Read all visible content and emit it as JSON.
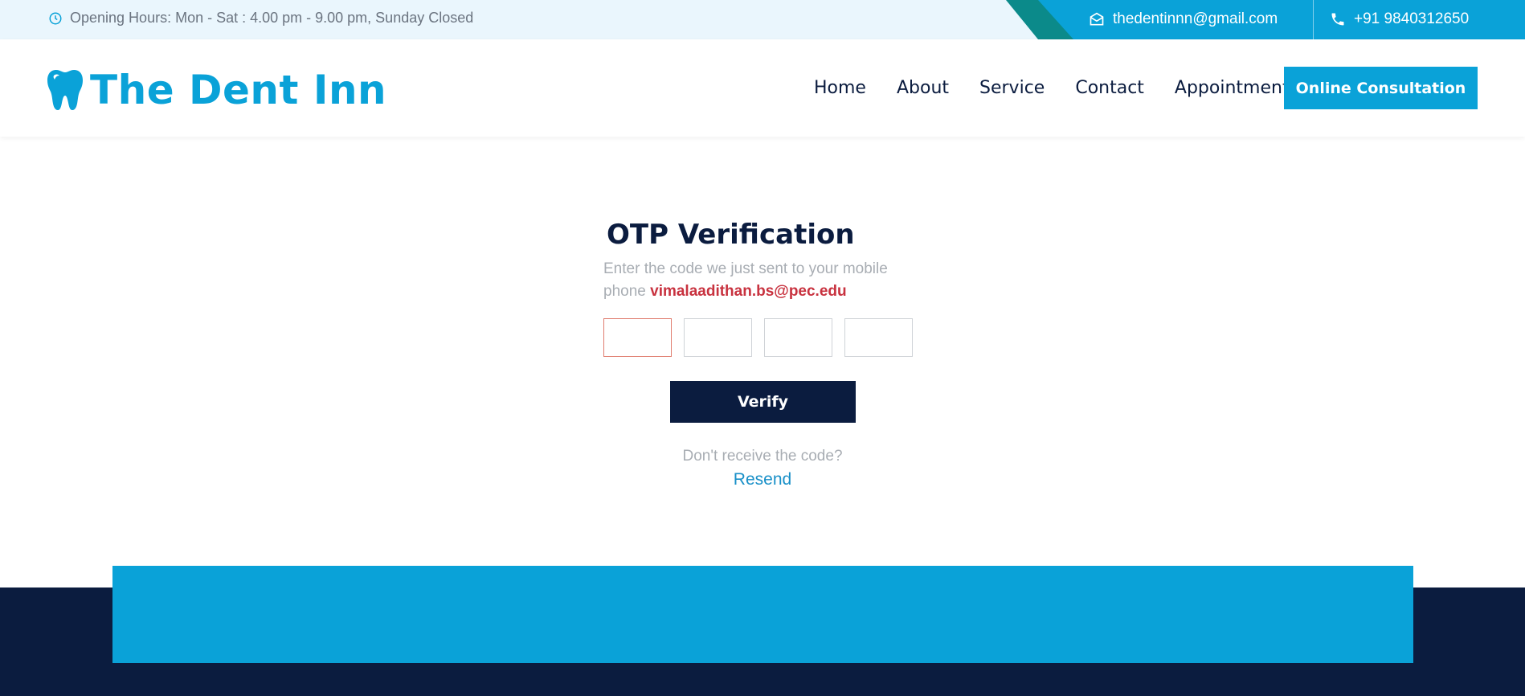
{
  "topbar": {
    "hours_icon": "clock-icon",
    "hours": "Opening Hours: Mon - Sat : 4.00 pm - 9.00 pm, Sunday Closed",
    "email_icon": "envelope-open-icon",
    "email": "thedentinnn@gmail.com",
    "phone_icon": "phone-icon",
    "phone": "+91 9840312650"
  },
  "header": {
    "logo_icon": "tooth-icon",
    "brand": "The Dent Inn",
    "nav": [
      "Home",
      "About",
      "Service",
      "Contact",
      "Appointment"
    ],
    "cta": "Online Consultation"
  },
  "otp": {
    "title": "OTP Verification",
    "subtitle": "Enter the code we just sent to your mobile phone",
    "target": "vimalaadithan.bs@pec.edu",
    "digits": [
      "",
      "",
      "",
      ""
    ],
    "verify_label": "Verify",
    "no_code": "Don't receive the code?",
    "resend": "Resend"
  },
  "colors": {
    "primary": "#0aa2d8",
    "navy": "#0b1c3f",
    "teal": "#0b8a8a",
    "highlight": "#c8323f",
    "topbar_bg": "#eaf6fd"
  }
}
